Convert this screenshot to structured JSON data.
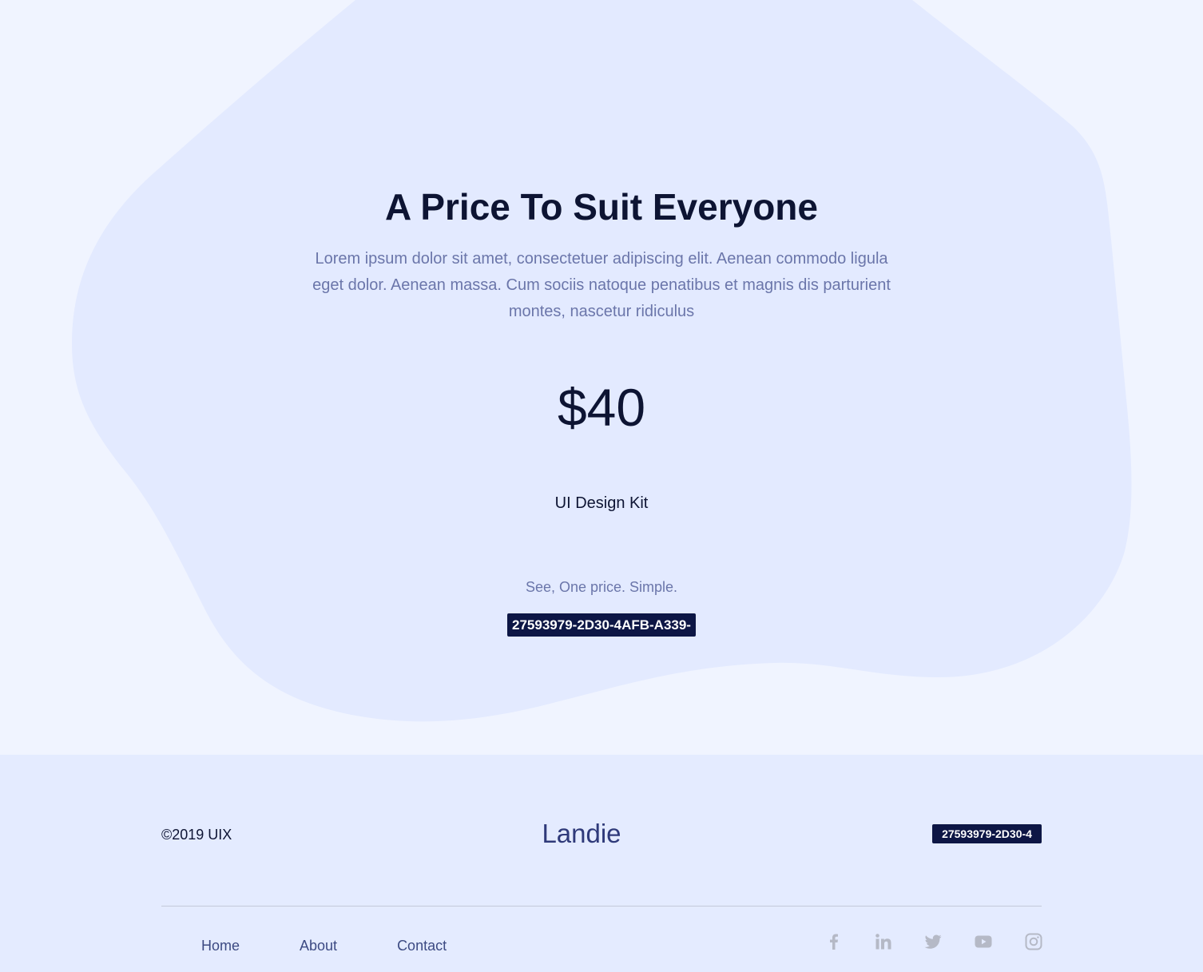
{
  "hero": {
    "title": "A Price To Suit Everyone",
    "description": "Lorem ipsum dolor sit amet, consectetuer adipiscing elit. Aenean commodo ligula eget dolor. Aenean massa. Cum sociis natoque penatibus et magnis dis parturient montes, nascetur ridiculus",
    "price": "$40",
    "product": "UI Design Kit",
    "tagline": "See, One price. Simple.",
    "code": "27593979-2D30-4AFB-A339-"
  },
  "footer": {
    "copyright": "©2019 UIX",
    "brand": "Landie",
    "code": "27593979-2D30-4",
    "nav": {
      "home": "Home",
      "about": "About",
      "contact": "Contact"
    },
    "social": [
      "facebook-icon",
      "linkedin-icon",
      "twitter-icon",
      "youtube-icon",
      "instagram-icon"
    ]
  },
  "colors": {
    "page_bg": "#f0f4ff",
    "blob": "#e3eaff",
    "footer_bg": "#e4ebff",
    "heading": "#0d1433",
    "muted": "#6b76aa",
    "badge_bg": "#0d1645",
    "social_icon": "#b5b9c6"
  }
}
